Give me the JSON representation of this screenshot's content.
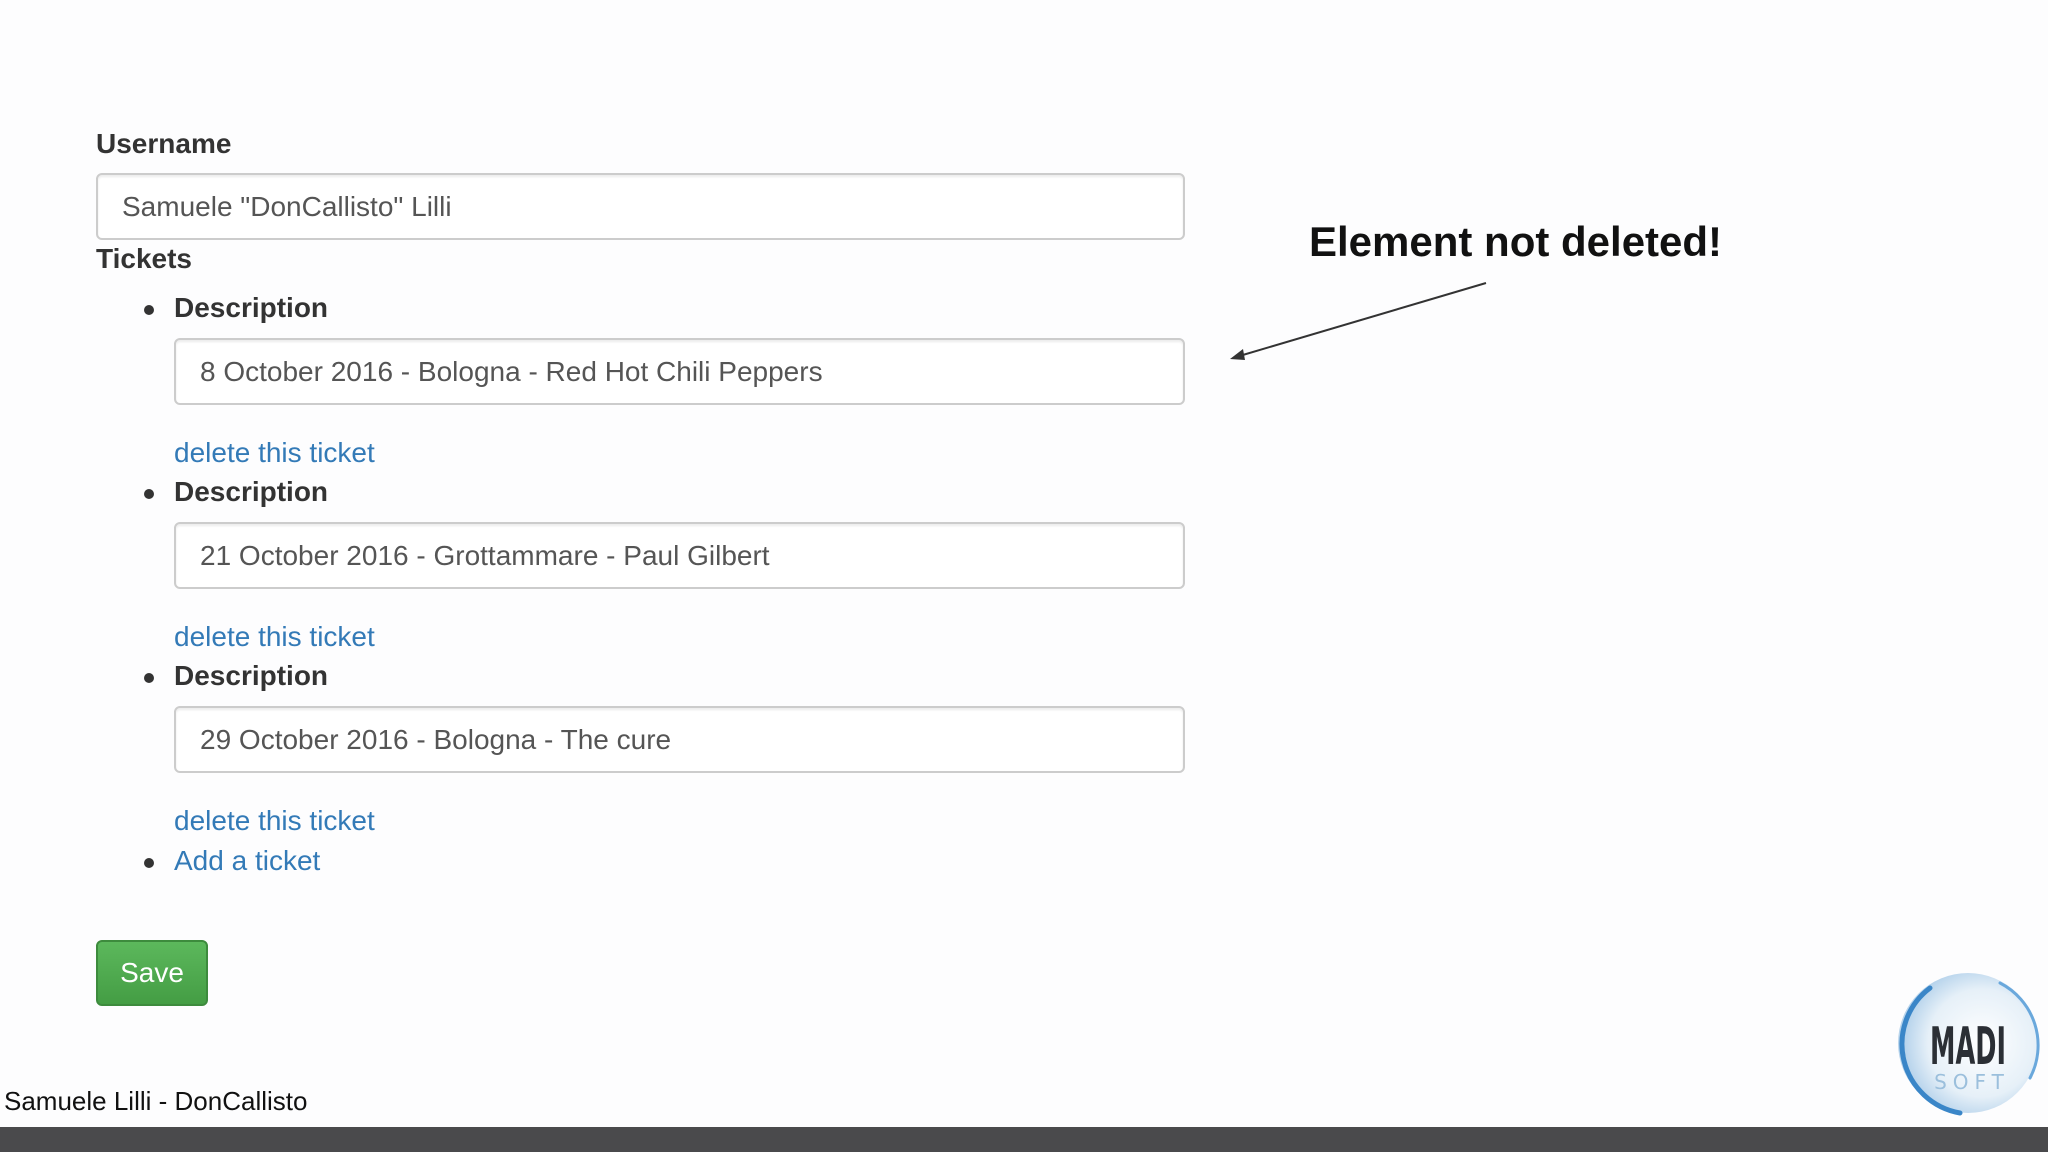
{
  "form": {
    "username_label": "Username",
    "username_value": "Samuele \"DonCallisto\" Lilli",
    "tickets_label": "Tickets",
    "tickets": [
      {
        "description_label": "Description",
        "value": "8 October 2016 - Bologna - Red Hot Chili Peppers",
        "delete_label": "delete this ticket"
      },
      {
        "description_label": "Description",
        "value": "21 October 2016 - Grottammare - Paul Gilbert",
        "delete_label": "delete this ticket"
      },
      {
        "description_label": "Description",
        "value": "29 October 2016 - Bologna - The cure",
        "delete_label": "delete this ticket"
      }
    ],
    "add_ticket_label": "Add a ticket",
    "save_label": "Save"
  },
  "annotation": {
    "text": "Element not deleted!"
  },
  "footer": {
    "author": "Samuele Lilli - DonCallisto"
  },
  "logo": {
    "name": "MADI SOFT",
    "line1": "MADI",
    "line2": "SOFT"
  },
  "colors": {
    "link": "#337ab7",
    "save_button": "#5cb85c",
    "footer_bar": "#4a4a4c",
    "logo_blue": "#3a86c8"
  }
}
